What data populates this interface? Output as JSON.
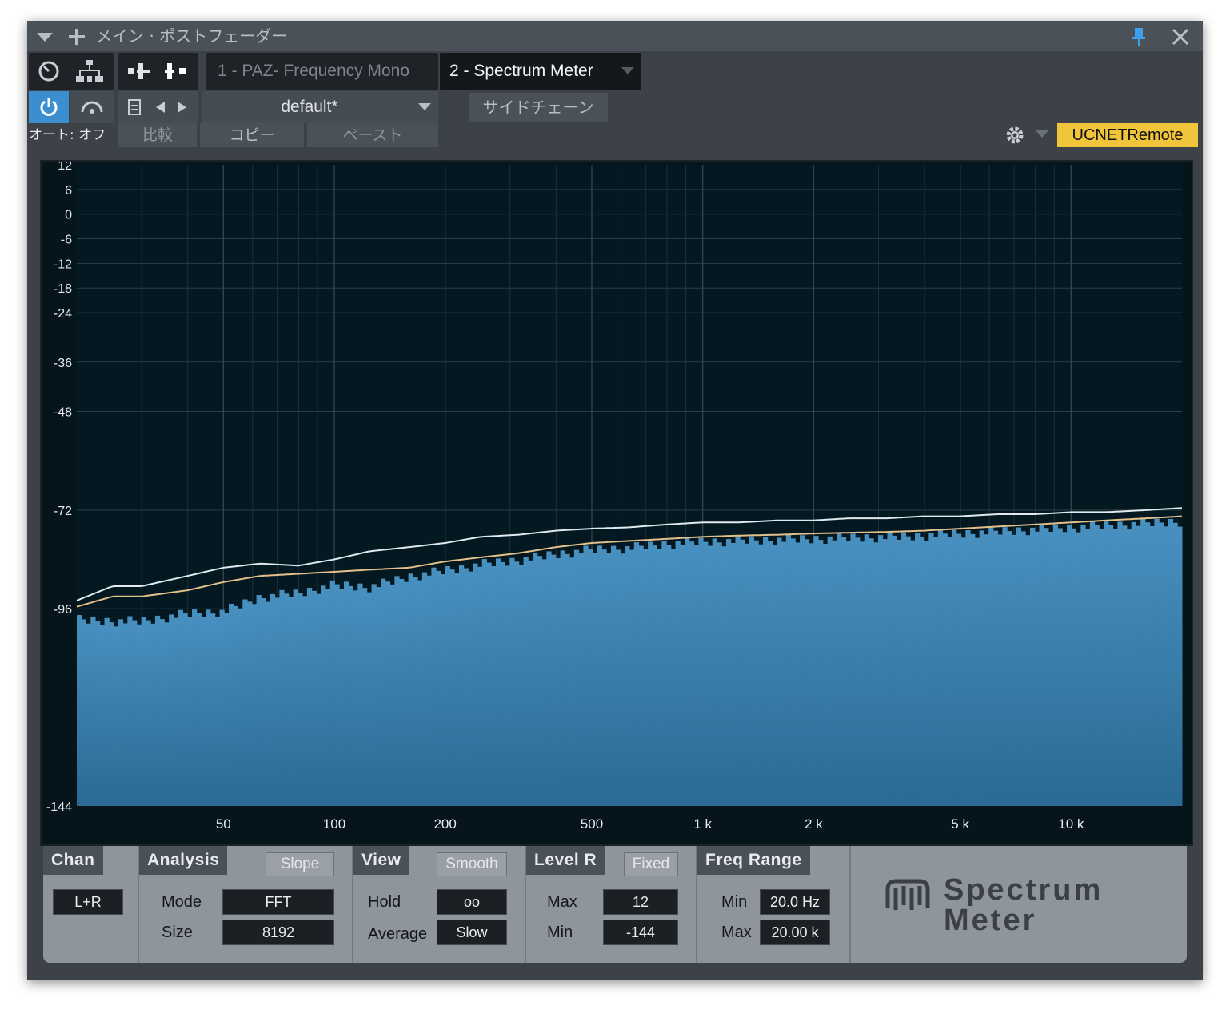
{
  "window": {
    "title": "メイン · ポストフェーダー"
  },
  "inserts": {
    "slot1": "1 - PAZ- Frequency Mono",
    "slot2": "2 - Spectrum Meter"
  },
  "toolbar": {
    "preset": "default*",
    "sidechain": "サイドチェーン",
    "auto": "オート: オフ",
    "compare": "比較",
    "copy": "コピー",
    "paste": "ペースト",
    "remote": "UCNETRemote"
  },
  "chart_data": {
    "type": "area",
    "xscale": "log",
    "xlim": [
      20,
      20000
    ],
    "ylim": [
      -144,
      12
    ],
    "grid": true,
    "y_ticks": [
      12,
      6,
      0,
      -6,
      -12,
      -18,
      -24,
      -36,
      -48,
      -72,
      -96,
      -144
    ],
    "x_ticks": [
      {
        "v": 50,
        "label": "50"
      },
      {
        "v": 100,
        "label": "100"
      },
      {
        "v": 200,
        "label": "200"
      },
      {
        "v": 500,
        "label": "500"
      },
      {
        "v": 1000,
        "label": "1 k"
      },
      {
        "v": 2000,
        "label": "2 k"
      },
      {
        "v": 5000,
        "label": "5 k"
      },
      {
        "v": 10000,
        "label": "10 k"
      }
    ],
    "series": [
      {
        "role": "spectrum",
        "color": "#3f87b5",
        "x": [
          20,
          25,
          30,
          40,
          50,
          63,
          80,
          100,
          125,
          160,
          200,
          250,
          315,
          400,
          500,
          630,
          800,
          1000,
          1250,
          1600,
          2000,
          2500,
          3150,
          4000,
          5000,
          6300,
          8000,
          10000,
          12500,
          16000,
          20000
        ],
        "y": [
          -97.5,
          -97.8,
          -97.8,
          -96,
          -95.5,
          -92,
          -91,
          -89,
          -89.5,
          -87,
          -85.5,
          -84,
          -83,
          -81.5,
          -80.5,
          -80,
          -79,
          -78.5,
          -78.2,
          -78,
          -77.8,
          -77.5,
          -77.3,
          -77,
          -76.5,
          -76,
          -75.5,
          -75,
          -74.5,
          -74,
          -73.5
        ]
      },
      {
        "role": "average",
        "color": "#e3c08a",
        "x": [
          20,
          25,
          30,
          40,
          50,
          63,
          80,
          100,
          125,
          160,
          200,
          250,
          315,
          400,
          500,
          630,
          800,
          1000,
          1250,
          1600,
          2000,
          2500,
          3150,
          4000,
          5000,
          6300,
          8000,
          10000,
          12500,
          16000,
          20000
        ],
        "y": [
          -95.5,
          -93,
          -93,
          -91.5,
          -89.5,
          -88,
          -87.5,
          -87,
          -86.5,
          -86,
          -84.5,
          -83.5,
          -82.5,
          -81,
          -80,
          -79.5,
          -79,
          -78.5,
          -78.2,
          -78,
          -77.7,
          -77.5,
          -77.3,
          -77,
          -76.5,
          -76,
          -75.5,
          -75,
          -74.5,
          -74,
          -73.5
        ]
      },
      {
        "role": "peak-hold",
        "color": "#dfe9ee",
        "x": [
          20,
          25,
          30,
          40,
          50,
          63,
          80,
          100,
          125,
          160,
          200,
          250,
          315,
          400,
          500,
          630,
          800,
          1000,
          1250,
          1600,
          2000,
          2500,
          3150,
          4000,
          5000,
          6300,
          8000,
          10000,
          12500,
          16000,
          20000
        ],
        "y": [
          -94,
          -90.5,
          -90.5,
          -88,
          -86,
          -85,
          -85.5,
          -84,
          -82,
          -81,
          -80,
          -78.5,
          -78,
          -77,
          -76.5,
          -76.2,
          -75.5,
          -75,
          -75,
          -74.5,
          -74.5,
          -74,
          -74,
          -73.5,
          -73.5,
          -73,
          -73,
          -72.5,
          -72.5,
          -72,
          -71.5
        ]
      }
    ]
  },
  "controls": {
    "chan": {
      "title": "Chan",
      "value": "L+R"
    },
    "analysis": {
      "title": "Analysis",
      "slope": "Slope",
      "mode_label": "Mode",
      "mode": "FFT",
      "size_label": "Size",
      "size": "8192"
    },
    "view": {
      "title": "View",
      "smooth": "Smooth",
      "hold_label": "Hold",
      "hold": "oo",
      "avg_label": "Average",
      "avg": "Slow"
    },
    "level": {
      "title": "Level R",
      "fixed": "Fixed",
      "max_label": "Max",
      "max": "12",
      "min_label": "Min",
      "min": "-144"
    },
    "freq": {
      "title": "Freq Range",
      "min_label": "Min",
      "min": "20.0 Hz",
      "max_label": "Max",
      "max": "20.00 k"
    }
  },
  "brand": {
    "line1": "Spectrum",
    "line2": "Meter"
  },
  "colors": {
    "accent": "#f0c53a",
    "power_on": "#3b8ed0",
    "spectrum": "#3f87b5"
  }
}
